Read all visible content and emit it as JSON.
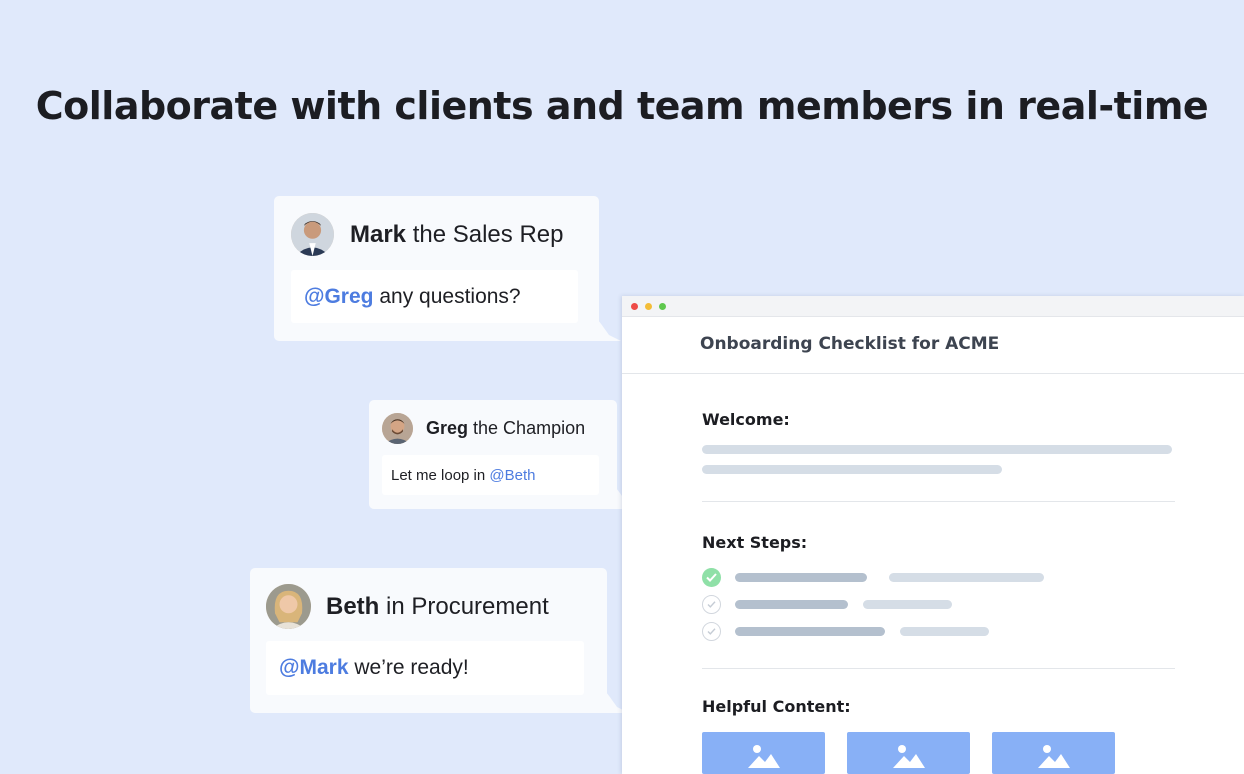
{
  "headline": "Collaborate with clients and team members in real-time",
  "colors": {
    "background": "#e0e9fb",
    "mention": "#4d7ce0",
    "check_done": "#8fe0a7",
    "image_placeholder": "#88b0f6"
  },
  "chat": [
    {
      "name": "Mark",
      "role": "the Sales Rep",
      "mention": "@Greg",
      "message": " any questions?",
      "avatar": "avatar-mark"
    },
    {
      "name": "Greg",
      "role": "the Champion",
      "pre": "Let me loop in ",
      "mention": "@Beth",
      "avatar": "avatar-greg"
    },
    {
      "name": "Beth",
      "role": "in Procurement",
      "mention": "@Mark",
      "message": " we’re ready!",
      "avatar": "avatar-beth"
    }
  ],
  "window": {
    "title": "Onboarding Checklist for ACME",
    "sections": {
      "welcome": "Welcome:",
      "next_steps": "Next Steps:",
      "helpful_content": "Helpful Content:"
    },
    "checklist": [
      {
        "done": true
      },
      {
        "done": false
      },
      {
        "done": false
      }
    ],
    "icons": [
      "image-icon",
      "image-icon",
      "image-icon"
    ]
  }
}
